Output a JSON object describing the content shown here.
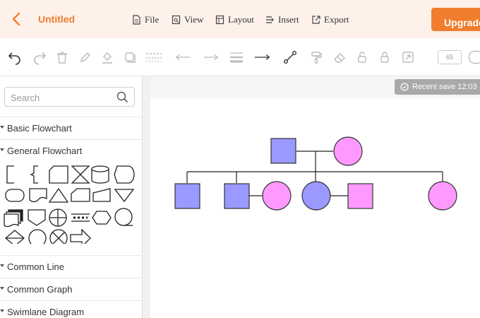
{
  "header": {
    "title": "Untitled",
    "menus": [
      {
        "label": "File",
        "icon": "file-icon"
      },
      {
        "label": "View",
        "icon": "view-icon"
      },
      {
        "label": "Layout",
        "icon": "layout-icon"
      },
      {
        "label": "Insert",
        "icon": "insert-icon"
      },
      {
        "label": "Export",
        "icon": "export-icon"
      }
    ],
    "upgrade_label": "Upgrade"
  },
  "toolbar": {
    "zoom": "65"
  },
  "sidebar": {
    "search_placeholder": "Search",
    "categories": [
      {
        "label": "Basic Flowchart"
      },
      {
        "label": "General Flowchart"
      },
      {
        "label": "Common Line"
      },
      {
        "label": "Common Graph"
      },
      {
        "label": "Swimlane Diagram"
      }
    ]
  },
  "canvas": {
    "save_status": "Recent save 12:03"
  },
  "colors": {
    "accent": "#f07e2e",
    "male_fill": "#9999ff",
    "female_fill": "#ff99ff"
  }
}
